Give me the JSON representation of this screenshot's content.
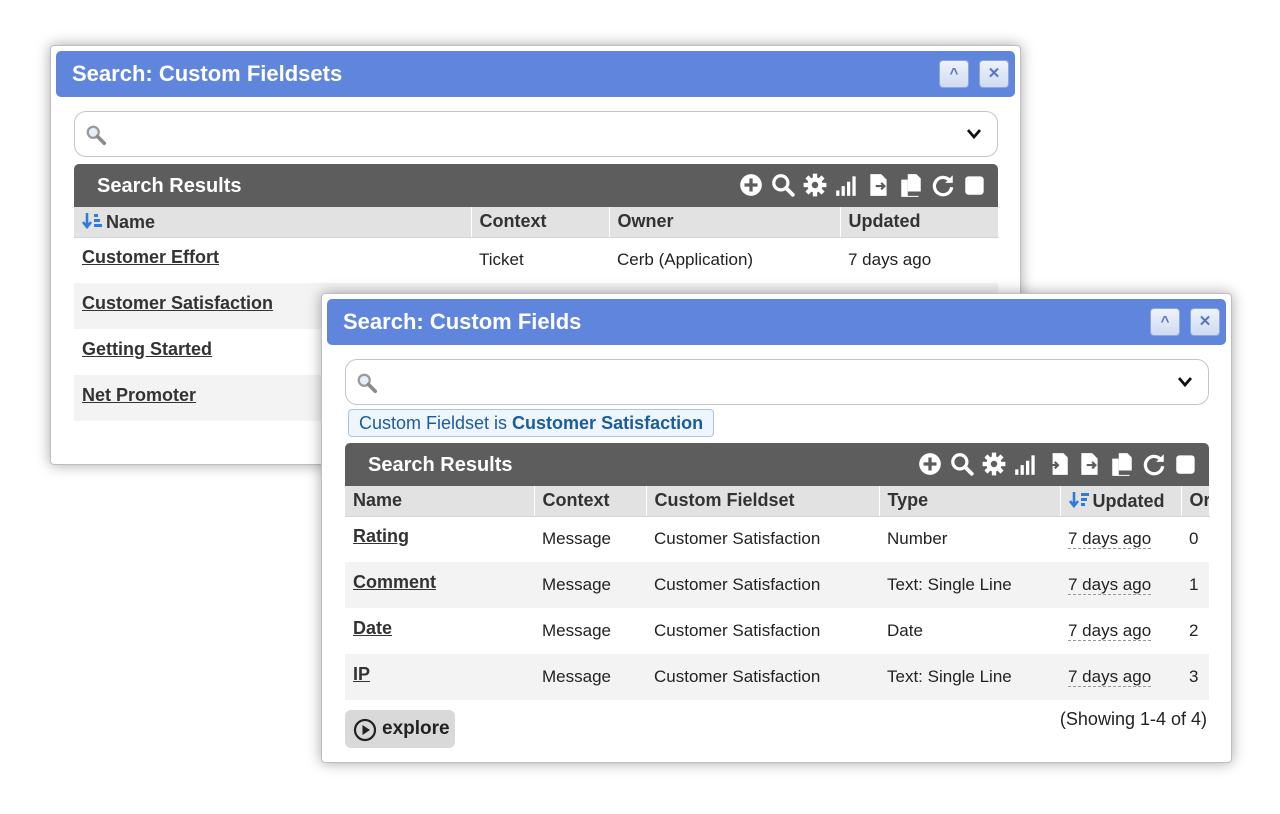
{
  "fieldsets_popup": {
    "title": "Search: Custom Fieldsets",
    "collapse_glyph": "^",
    "close_glyph": "✕",
    "search": {
      "placeholder": "",
      "value": ""
    },
    "results": {
      "title": "Search Results",
      "toolbar_icons": [
        "add-icon",
        "search-icon",
        "gear-icon",
        "chart-icon",
        "export-icon",
        "copy-icon",
        "refresh-icon",
        "checkbox"
      ],
      "columns": [
        "Name",
        "Context",
        "Owner",
        "Updated"
      ],
      "sorted_column": "Name",
      "rows": [
        {
          "name": "Customer Effort",
          "context": "Ticket",
          "owner": "Cerb (Application)",
          "updated": "7 days ago"
        },
        {
          "name": "Customer Satisfaction",
          "context": "",
          "owner": "",
          "updated": ""
        },
        {
          "name": "Getting Started",
          "context": "",
          "owner": "",
          "updated": ""
        },
        {
          "name": "Net Promoter",
          "context": "",
          "owner": "",
          "updated": ""
        }
      ]
    }
  },
  "fields_popup": {
    "title": "Search: Custom Fields",
    "collapse_glyph": "^",
    "close_glyph": "✕",
    "search": {
      "placeholder": "",
      "value": ""
    },
    "filter_chip": {
      "prefix": "Custom Fieldset is ",
      "value": "Customer Satisfaction"
    },
    "results": {
      "title": "Search Results",
      "toolbar_icons": [
        "add-icon",
        "search-icon",
        "gear-icon",
        "chart-icon",
        "import-icon",
        "export-icon",
        "copy-icon",
        "refresh-icon",
        "checkbox"
      ],
      "columns": [
        "Name",
        "Context",
        "Custom Fieldset",
        "Type",
        "Updated",
        "Or"
      ],
      "sorted_column": "Updated",
      "rows": [
        {
          "name": "Rating",
          "context": "Message",
          "fieldset": "Customer Satisfaction",
          "type": "Number",
          "updated": "7 days ago",
          "order": "0"
        },
        {
          "name": "Comment",
          "context": "Message",
          "fieldset": "Customer Satisfaction",
          "type": "Text: Single Line",
          "updated": "7 days ago",
          "order": "1"
        },
        {
          "name": "Date",
          "context": "Message",
          "fieldset": "Customer Satisfaction",
          "type": "Date",
          "updated": "7 days ago",
          "order": "2"
        },
        {
          "name": "IP",
          "context": "Message",
          "fieldset": "Customer Satisfaction",
          "type": "Text: Single Line",
          "updated": "7 days ago",
          "order": "3"
        }
      ],
      "explore_label": "explore",
      "showing_text": "(Showing 1-4 of 4)"
    }
  },
  "colors": {
    "titlebar": "#6085dc",
    "results_bar": "#5d5d5d",
    "link_blue": "#1b5d9c",
    "sort_arrow": "#2f7bd6"
  }
}
